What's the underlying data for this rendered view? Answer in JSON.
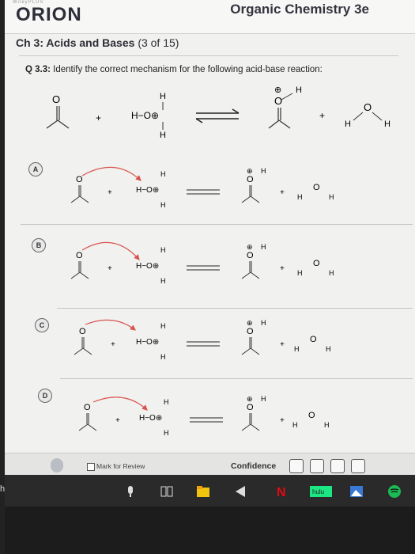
{
  "header": {
    "brand_small": "WileyPLUS",
    "brand": "ORION",
    "book_title": "Organic Chemistry 3e"
  },
  "chapter": {
    "title": "Ch 3: Acids and Bases",
    "progress": "(3 of 15)"
  },
  "question": {
    "number": "Q 3.3:",
    "text": "Identify the correct mechanism for the following acid-base reaction:"
  },
  "chem_labels": {
    "oxygen": "O",
    "hydrogen": "H",
    "hydronium": "H−O⊕",
    "plus": "+",
    "charge": "⊕"
  },
  "options": [
    {
      "label": "A"
    },
    {
      "label": "B"
    },
    {
      "label": "C"
    },
    {
      "label": "D"
    }
  ],
  "footer": {
    "mark_for_review": "Mark for Review",
    "confidence": "Confidence"
  },
  "taskbar": {
    "left_label": "h",
    "app_label": "hulu"
  },
  "colors": {
    "arrow_red": "#d9534f",
    "taskbar": "#2a2a2a"
  }
}
